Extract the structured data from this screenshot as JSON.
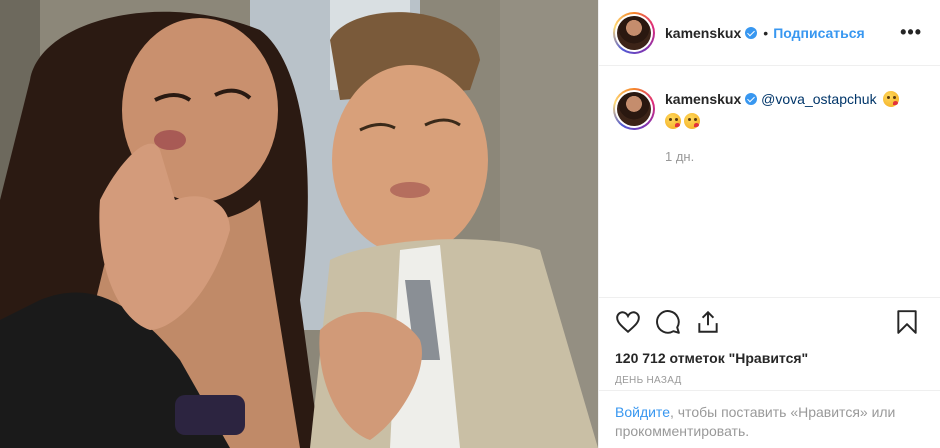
{
  "post": {
    "username": "kamenskux",
    "follow_label": "Подписаться",
    "dot": "•",
    "more_label": "•••"
  },
  "caption": {
    "username": "kamenskux",
    "mention": "@vova_ostapchuk",
    "time": "1 дн."
  },
  "actions": {
    "likes": "120 712 отметок \"Нравится\"",
    "posted": "ДЕНЬ НАЗАД"
  },
  "login": {
    "link": "Войдите",
    "rest": ", чтобы поставить «Нравится» или прокомментировать."
  },
  "icons": {
    "heart": "heart-icon",
    "comment": "comment-icon",
    "share": "share-icon",
    "save": "bookmark-icon",
    "verified": "verified-badge-icon"
  },
  "colors": {
    "link_blue": "#3897f0",
    "mention": "#003569",
    "muted": "#999999"
  }
}
